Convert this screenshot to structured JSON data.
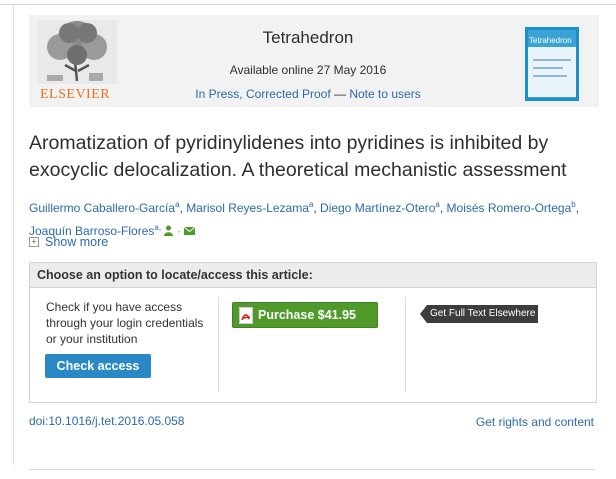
{
  "header": {
    "publisher_logo": "ELSEVIER",
    "journal": "Tetrahedron",
    "available_online": "Available online 27 May 2016",
    "status": "In Press, Corrected Proof",
    "status_separator": " — ",
    "note_link": "Note to users",
    "cover_title": "Tetrahedron"
  },
  "article": {
    "title": "Aromatization of pyridinylidenes into pyridines is inhibited by exocyclic delocalization. A theoretical mechanistic assessment"
  },
  "authors": [
    {
      "name": "Guillermo Caballero-García",
      "sup": "a",
      "sep": ", "
    },
    {
      "name": "Marisol Reyes-Lezama",
      "sup": "a",
      "sep": ", "
    },
    {
      "name": "Diego Martínez-Otero",
      "sup": "a",
      "sep": ", "
    },
    {
      "name": "Moisés Romero-Ortega",
      "sup": "b",
      "sep": ","
    },
    {
      "name": "Joaquín Barroso-Flores",
      "sup": "a,",
      "sep": ""
    }
  ],
  "icons": {
    "person": "person-icon",
    "email": "email-icon",
    "expand": "plus-square-icon",
    "pdf": "pdf-icon"
  },
  "show_more": "Show more",
  "access": {
    "heading": "Choose an option to locate/access this article:",
    "description": "Check if you have access through your login credentials or your institution",
    "check_button": "Check access",
    "purchase_button": "Purchase $41.95",
    "elsewhere_button": "Get Full Text Elsewhere"
  },
  "footer": {
    "doi": "doi:10.1016/j.tet.2016.05.058",
    "rights": "Get rights and content"
  },
  "colors": {
    "link": "#2c6aab",
    "elsevier_orange": "#e9711c",
    "purchase_green": "#4f9a2b",
    "check_blue": "#2a88c7",
    "elsewhere_dark": "#3d3d3d"
  }
}
